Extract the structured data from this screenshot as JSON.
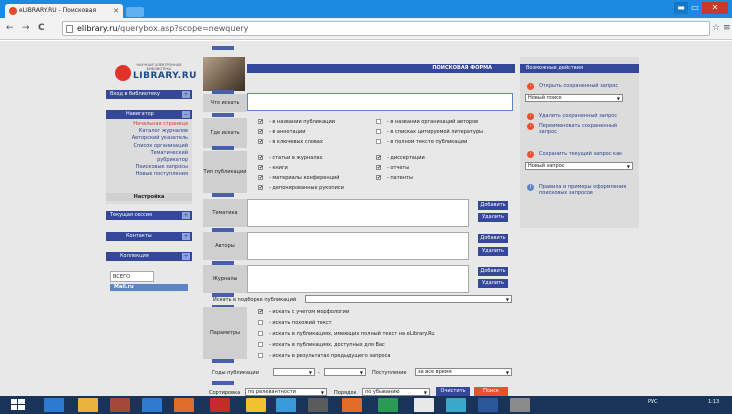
{
  "browser": {
    "tab_title": "eLIBRARY.RU - Поисковая",
    "tab_close": "✕",
    "url_domain": "elibrary.ru",
    "url_path": "/querybox.asp?scope=newquery",
    "back": "←",
    "forward": "→",
    "reload": "C",
    "star": "☆",
    "menu": "≡",
    "win_min": "▬",
    "win_max": "▭",
    "win_close": "✕"
  },
  "logo": {
    "line1": "НАУЧНАЯ ЭЛЕКТРОННАЯ",
    "line2": "БИБЛИОТЕКА",
    "brand": "LIBRARY.RU"
  },
  "left": {
    "login": "Вход в библиотеку",
    "navigator": "Навигатор",
    "nav_items": [
      "Начальная страница",
      "Каталог журналов",
      "Авторский указатель",
      "Список организаций",
      "Тематический",
      "рубрикатор",
      "Поисковые запросы",
      "Новые поступления"
    ],
    "settings": "Настройка",
    "session": "Текущая сессия",
    "contacts": "Контакты",
    "counter": "Коллекция",
    "counter_val": "ВСЕГО",
    "counter2": "Mail.ru"
  },
  "form": {
    "title": "ПОИСКОВАЯ ФОРМА",
    "what": "Что искать",
    "where": "Где искать",
    "type": "Тип публикации",
    "topic": "Тематика",
    "authors": "Авторы",
    "journals": "Журналы",
    "in_set": "Искать в подборке публикаций",
    "params": "Параметры",
    "years": "Годы публикации",
    "received": "Поступление",
    "received_val": "за все время",
    "sort": "Сортировка",
    "sort_val": "по релевантности",
    "order": "Порядок",
    "order_val": "по убыванию",
    "clear": "Очистить",
    "search": "Поиск",
    "add": "Добавить",
    "remove": "Удалить",
    "where_opts": [
      "- в названии публикации",
      "- в аннотации",
      "- в ключевых словах",
      "- в названии организаций авторов",
      "- в списках цитируемой литературы",
      "- в полном тексте публикации"
    ],
    "type_opts": [
      "- статьи в журналах",
      "- книги",
      "- материалы конференций",
      "- депонированные рукописи",
      "- диссертации",
      "- отчеты",
      "- патенты"
    ],
    "param_opts": [
      "- искать с учетом морфологии",
      "- искать похожий текст",
      "- искать в публикациях, имеющих полный текст на eLibrary.Ru",
      "- искать в публикациях, доступных для Вас",
      "- искать в результатах предыдущего запроса"
    ],
    "check": "✔"
  },
  "right": {
    "title": "Возможные действия",
    "open": "Открыть сохраненный запрос",
    "new_search": "Новый поиск",
    "delete": "Удалить сохраненный запрос",
    "rename": "Переименовать сохраненный запрос",
    "save": "Сохранить текущий запрос как",
    "new_query": "Новый запрос",
    "rules": "Правила и примеры оформления поисковых запросов"
  },
  "tray": {
    "lang": "РУС",
    "time": "1:13"
  },
  "colors": {
    "brand_blue": "#34479a",
    "accent_red": "#e8502e",
    "title_bar": "#1b8ae0",
    "taskbar": "#1a3358"
  }
}
